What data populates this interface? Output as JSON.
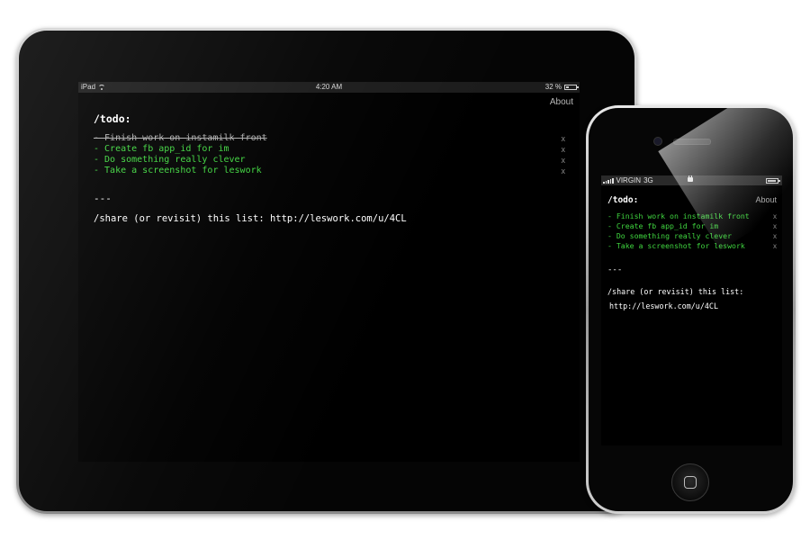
{
  "ipad": {
    "status_bar": {
      "device": "iPad",
      "time": "4:20 AM",
      "battery": "32 %",
      "battery_level": 0.32
    },
    "about_label": "About",
    "heading": "/todo:",
    "todos": [
      {
        "text": "- Finish work on instamilk front",
        "done": true,
        "delete": "x"
      },
      {
        "text": "- Create fb app_id for im",
        "done": false,
        "delete": "x"
      },
      {
        "text": "- Do something really clever",
        "done": false,
        "delete": "x"
      },
      {
        "text": "- Take a screenshot for leswork",
        "done": false,
        "delete": "x"
      }
    ],
    "separator": "---",
    "share_text": "/share (or revisit) this list: http://leswork.com/u/4CL"
  },
  "iphone": {
    "status_bar": {
      "carrier": "VIRGIN",
      "network": "3G",
      "battery_level": 0.9
    },
    "about_label": "About",
    "heading": "/todo:",
    "todos": [
      {
        "text": "- Finish work on instamilk front",
        "delete": "x"
      },
      {
        "text": "- Create fb app_id for im",
        "delete": "x"
      },
      {
        "text": "- Do something really clever",
        "delete": "x"
      },
      {
        "text": "- Take a screenshot for leswork",
        "delete": "x"
      }
    ],
    "separator": "---",
    "share_text": "/share (or revisit) this list:",
    "share_url": "http://leswork.com/u/4CL"
  },
  "colors": {
    "todo_green": "#3fd53f",
    "done_gray": "#b0b0b0",
    "background": "#000000"
  }
}
